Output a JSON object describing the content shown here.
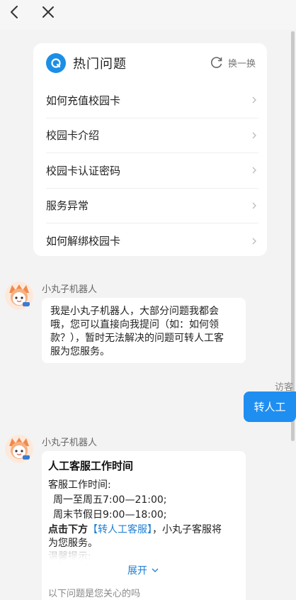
{
  "hot_questions": {
    "title": "热门问题",
    "refresh_label": "换一换",
    "items": [
      {
        "label": "如何充值校园卡"
      },
      {
        "label": "校园卡介绍"
      },
      {
        "label": "校园卡认证密码"
      },
      {
        "label": "服务异常"
      },
      {
        "label": "如何解绑校园卡"
      }
    ]
  },
  "messages": {
    "bot_name": "小丸子机器人",
    "bot_intro_lines": [
      "我是小丸子机器人，大部分问题我都会",
      "哦，您可以直接向我提问（如：如何领",
      "款？），暂时无法解决的问题可转人工客",
      "服为您服务。"
    ],
    "visitor_label": "访客",
    "user_message": "转人工",
    "service_card": {
      "title": "人工客服工作时间",
      "hours_label": "客服工作时间:",
      "weekday_hours": "周一至周五7:00—21:00;",
      "weekend_hours": "周末节假日9:00—18:00;",
      "instruction_prefix": "点击下方",
      "instruction_link": "【转人工客服】",
      "instruction_suffix": "，小丸子客服将",
      "instruction_line2": "为您服务。",
      "tip_label": "温馨提示:",
      "expand_label": "展开",
      "footer_text": "以下问题是您关心的吗"
    }
  },
  "colors": {
    "accent": "#1f8ef1",
    "link": "#1f7ed4",
    "background": "#f3f3f3"
  }
}
